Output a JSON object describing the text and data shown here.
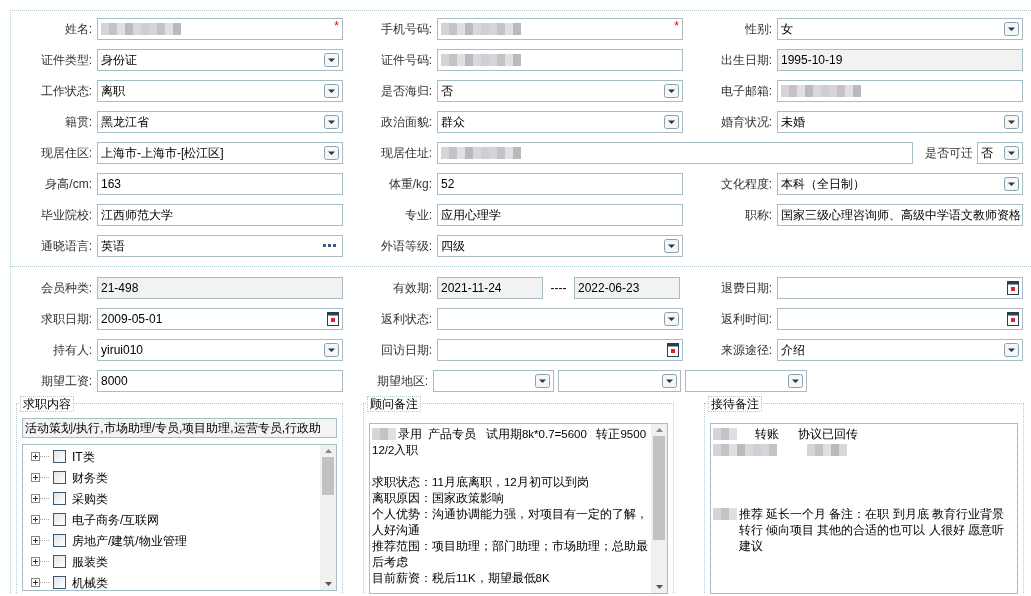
{
  "basic": {
    "rows": [
      {
        "fields": [
          {
            "label": "姓名:",
            "kind": "required",
            "mark": "*",
            "blurred": true
          },
          {
            "label": "手机号码:",
            "kind": "required",
            "mark": "*",
            "blurred": true
          },
          {
            "label": "性别:",
            "kind": "select",
            "value": "女"
          }
        ]
      },
      {
        "fields": [
          {
            "label": "证件类型:",
            "kind": "select",
            "value": "身份证"
          },
          {
            "label": "证件号码:",
            "kind": "text",
            "blurred": true
          },
          {
            "label": "出生日期:",
            "kind": "readonly",
            "value": "1995-10-19"
          }
        ]
      },
      {
        "fields": [
          {
            "label": "工作状态:",
            "kind": "select",
            "value": "离职"
          },
          {
            "label": "是否海归:",
            "kind": "select",
            "value": "否"
          },
          {
            "label": "电子邮箱:",
            "kind": "text",
            "blurred": true
          }
        ]
      },
      {
        "fields": [
          {
            "label": "籍贯:",
            "kind": "select",
            "value": "黑龙江省"
          },
          {
            "label": "政治面貌:",
            "kind": "select",
            "value": "群众"
          },
          {
            "label": "婚育状况:",
            "kind": "select",
            "value": "未婚"
          }
        ]
      },
      {
        "fields": [
          {
            "label": "现居住区:",
            "kind": "select",
            "value": " 上海市-上海市-[松江区]"
          },
          {
            "label": "现居住址:",
            "kind": "text",
            "blurred": true
          },
          {
            "label": "是否可迁",
            "kind": "select",
            "value": "否"
          }
        ]
      },
      {
        "fields": [
          {
            "label": "身高/cm:",
            "kind": "text",
            "value": "163"
          },
          {
            "label": "体重/kg:",
            "kind": "text",
            "value": "52"
          },
          {
            "label": "文化程度:",
            "kind": "select",
            "value": "本科（全日制）"
          }
        ]
      },
      {
        "fields": [
          {
            "label": "毕业院校:",
            "kind": "text",
            "value": "江西师范大学"
          },
          {
            "label": "专业:",
            "kind": "text",
            "value": "应用心理学"
          },
          {
            "label": "职称:",
            "kind": "text",
            "value": "国家三级心理咨询师、高级中学语文教师资格"
          }
        ]
      },
      {
        "fields": [
          {
            "label": "通晓语言:",
            "kind": "lookup",
            "value": "英语"
          },
          {
            "label": "外语等级:",
            "kind": "select",
            "value": "四级"
          }
        ]
      }
    ]
  },
  "membership": {
    "rows": [
      {
        "fields": [
          {
            "label": "会员种类:",
            "kind": "readonly",
            "value": "21-498"
          },
          {
            "label": "有效期:",
            "kind": "range",
            "values": [
              "2021-11-24",
              "2022-06-23"
            ],
            "separator": "----"
          },
          {
            "label": "退费日期:",
            "kind": "date"
          }
        ]
      },
      {
        "fields": [
          {
            "label": "求职日期:",
            "kind": "date",
            "value": "2009-05-01"
          },
          {
            "label": "返利状态:",
            "kind": "select"
          },
          {
            "label": "返利时间:",
            "kind": "date"
          }
        ]
      },
      {
        "fields": [
          {
            "label": "持有人:",
            "kind": "select",
            "value": "yirui010"
          },
          {
            "label": "回访日期:",
            "kind": "date"
          },
          {
            "label": "来源途径:",
            "kind": "select",
            "value": "介绍"
          }
        ]
      },
      {
        "fields": [
          {
            "label": "期望工资:",
            "kind": "text",
            "value": "8000"
          },
          {
            "label": "期望地区:",
            "kind": "region"
          }
        ]
      }
    ]
  },
  "job_content": {
    "legend": "求职内容",
    "selected_text": "活动策划/执行,市场助理/专员,项目助理,运营专员,行政助",
    "tree": [
      {
        "label": "IT类",
        "checked": false,
        "expanded": false
      },
      {
        "label": "财务类",
        "checked": false,
        "expanded": false
      },
      {
        "label": "采购类",
        "checked": false,
        "expanded": false
      },
      {
        "label": "电子商务/互联网",
        "checked": false,
        "expanded": false
      },
      {
        "label": "房地产/建筑/物业管理",
        "checked": false,
        "expanded": false
      },
      {
        "label": "服装类",
        "checked": false,
        "expanded": false
      },
      {
        "label": "机械类",
        "checked": false,
        "expanded": false
      }
    ]
  },
  "advisor_notes": {
    "legend": "顾问备注",
    "lines": [
      {
        "kind": "text",
        "text": "录用  产品专员   试用期8k*0.7=5600   转正9500",
        "blurred": true
      },
      {
        "kind": "text",
        "text": "12/2入职",
        "blurred": false
      },
      {
        "kind": "blank"
      },
      {
        "kind": "text",
        "text": "求职状态：11月底离职，12月初可以到岗",
        "blurred": false
      },
      {
        "kind": "text",
        "text": "离职原因：国家政策影响",
        "blurred": false
      },
      {
        "kind": "text",
        "text": "个人优势：沟通协调能力强，对项目有一定的了解，人好沟通",
        "blurred": false
      },
      {
        "kind": "text",
        "text": "推荐范围：项目助理；部门助理；市场助理；总助最后考虑",
        "blurred": false
      },
      {
        "kind": "text",
        "text": "目前薪资：税后11K，期望最低8K",
        "blurred": false
      }
    ]
  },
  "reception_notes": {
    "legend": "接待备注",
    "lines": [
      {
        "kind": "text",
        "text": "     转账      协议已回传",
        "blurred": true
      },
      {
        "kind": "redacted"
      },
      {
        "kind": "blank"
      },
      {
        "kind": "blank"
      },
      {
        "kind": "blank"
      },
      {
        "kind": "text",
        "text": "推荐 延长一个月 备注：在职 到月底 教育行业背景转行 倾向项目 其他的合适的也可以 人很好 愿意听建议",
        "blurred": true
      }
    ]
  }
}
